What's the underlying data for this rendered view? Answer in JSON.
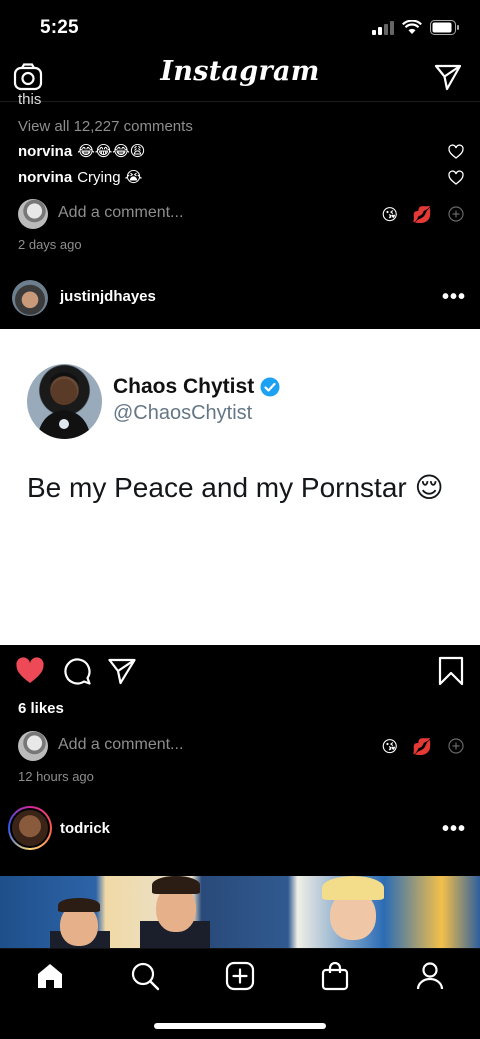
{
  "status": {
    "time": "5:25"
  },
  "app": {
    "title": "Instagram"
  },
  "prev_post": {
    "cut_caption": "this",
    "view_all_comments": "View all 12,227 comments",
    "comments": [
      {
        "user": "norvina",
        "text": "😂😂😂😩"
      },
      {
        "user": "norvina",
        "text": "Crying 😭"
      }
    ],
    "add_comment_placeholder": "Add a comment...",
    "quick_emojis": [
      "😘",
      "💋"
    ],
    "timestamp": "2 days ago"
  },
  "post": {
    "username": "justinjdhayes",
    "more": "•••",
    "tweet": {
      "name": "Chaos Chytist",
      "handle": "@ChaosChytist",
      "text": "Be my Peace and my Pornstar 😌",
      "verified": true
    },
    "liked": true,
    "likes": "6 likes",
    "add_comment_placeholder": "Add a comment...",
    "quick_emojis": [
      "😘",
      "💋"
    ],
    "timestamp": "12 hours ago"
  },
  "next_post": {
    "username": "todrick",
    "more": "•••"
  },
  "tabs": [
    "home-icon",
    "search-icon",
    "add-post-icon",
    "shop-icon",
    "profile-icon"
  ],
  "colors": {
    "like": "#ed4956",
    "verified": "#1da1f2",
    "muted": "#8e8e8e"
  }
}
